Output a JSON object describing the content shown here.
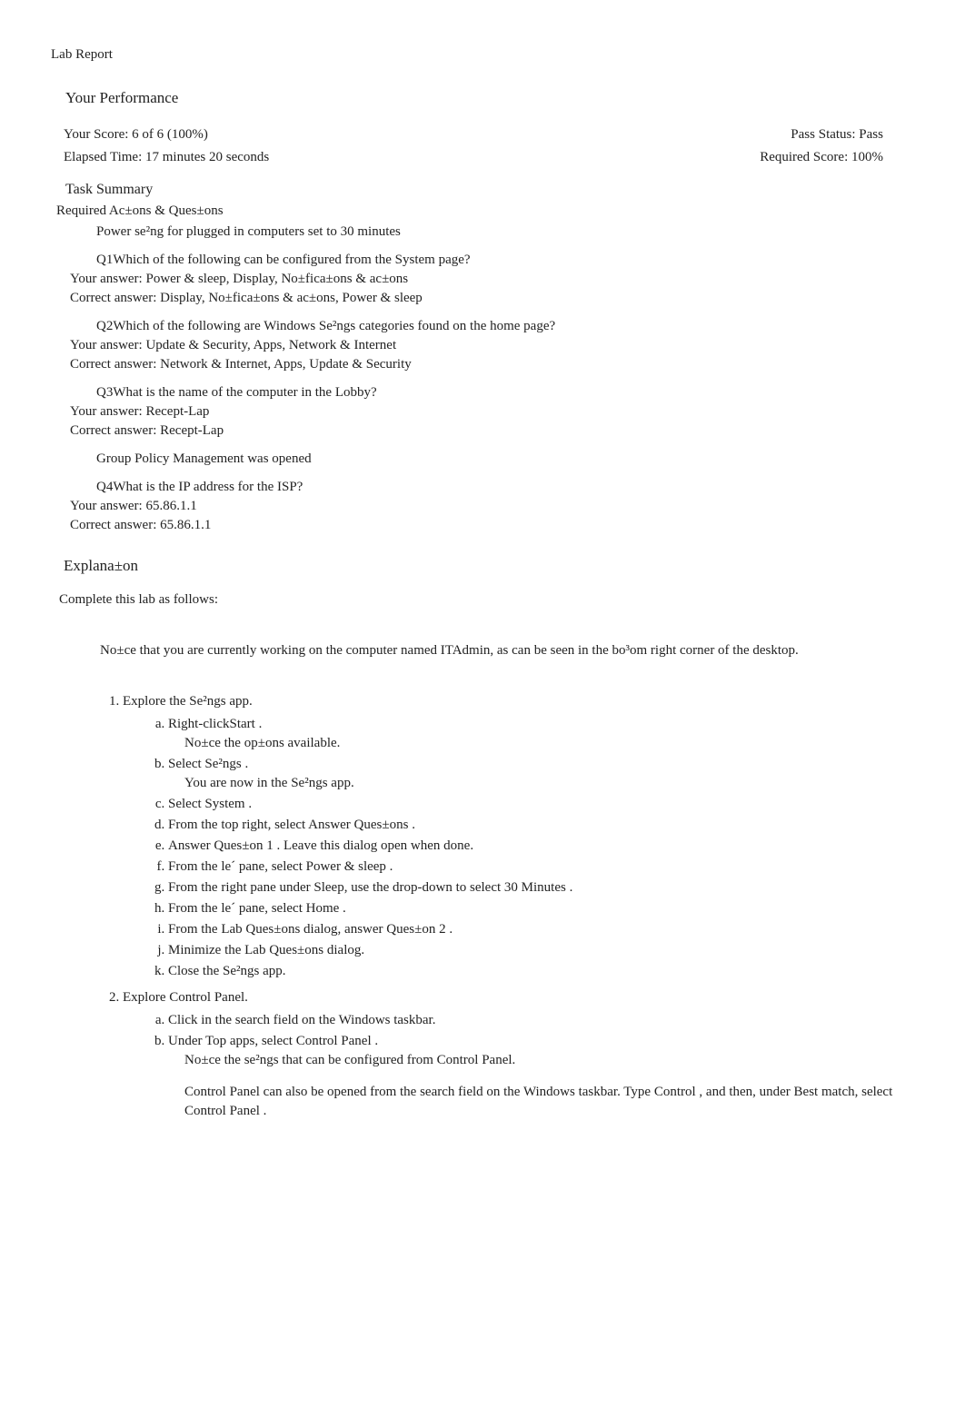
{
  "header": {
    "title": "Lab Report"
  },
  "performance": {
    "heading": "Your Performance",
    "score_label": "Your Score: 6 of 6 (100%)",
    "pass_label": "Pass Status: Pass",
    "elapsed_label": "Elapsed Time: 17 minutes 20 seconds",
    "required_label": "Required Score: 100%"
  },
  "task_summary": {
    "heading": "Task Summary",
    "required_heading": "Required Ac±ons & Ques±ons",
    "action1": "Power se²ng for plugged in computers set to 30 minutes",
    "q1": {
      "question": "Q1Which of the following can be configured from the System page?",
      "your": "Your answer: Power & sleep, Display, No±fica±ons & ac±ons",
      "correct": "Correct answer: Display, No±fica±ons & ac±ons, Power & sleep"
    },
    "q2": {
      "question": "Q2Which of the following are Windows Se²ngs categories found on the home page?",
      "your": "Your answer: Update & Security, Apps, Network & Internet",
      "correct": "Correct answer: Network & Internet, Apps, Update & Security"
    },
    "q3": {
      "question": "Q3What is the name of the computer in the Lobby?",
      "your": "Your answer: Recept-Lap",
      "correct": "Correct answer: Recept-Lap"
    },
    "action2": "Group Policy Management was opened",
    "q4": {
      "question": "Q4What is the IP address for the ISP?",
      "your": "Your answer: 65.86.1.1",
      "correct": "Correct answer: 65.86.1.1"
    }
  },
  "explanation": {
    "heading": "Explana±on",
    "intro": "Complete this lab as follows:",
    "notice": "No±ce that you are currently working on the computer named ITAdmin, as can be seen in the bo³om right corner of the desktop.",
    "step1": {
      "title": "Explore the Se²ngs app.",
      "a": "Right-clickStart .",
      "a_note": "No±ce the op±ons available.",
      "b": "Select Se²ngs  .",
      "b_note": "You are now in the Se²ngs app.",
      "c": "Select System .",
      "d": "From the top right, select  Answer Ques±ons .",
      "e": "Answer Ques±on 1 . Leave this dialog open when done.",
      "f": "From the le´ pane, select   Power & sleep .",
      "g": "From the right pane under Sleep, use the drop-down to select    30 Minutes .",
      "h": "From the le´ pane, select   Home .",
      "i": "From the Lab Ques±ons dialog, answer Ques±on 2 .",
      "j": "Minimize the Lab Ques±ons dialog.",
      "k": "Close the Se²ngs   app."
    },
    "step2": {
      "title": "Explore Control Panel.",
      "a": "Click in the search field on the Windows taskbar.",
      "b": "Under Top apps, select  Control Panel .",
      "b_note": "No±ce the se²ngs that can be configured from Control Panel.",
      "b_extra": "Control Panel can also be opened from the search field on the Windows taskbar. Type   Control , and then, under Best match, select   Control Panel ."
    }
  }
}
